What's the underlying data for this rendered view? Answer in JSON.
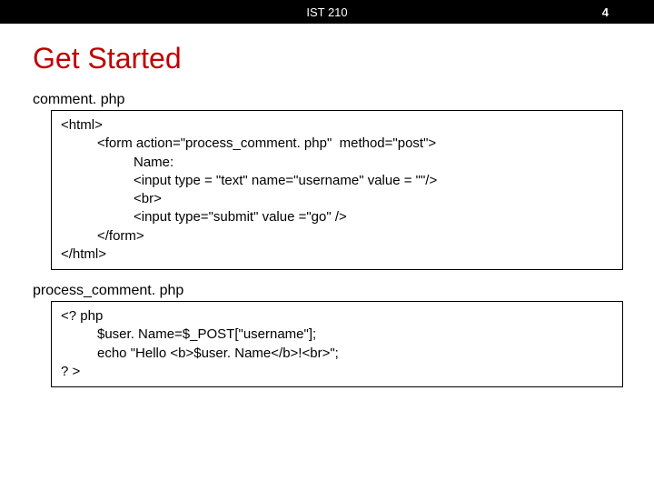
{
  "header": {
    "course": "IST 210",
    "page_number": "4"
  },
  "title": "Get Started",
  "file1": {
    "name": "comment. php",
    "code": {
      "l1": "<html>",
      "l2": "<form action=\"process_comment. php\"  method=\"post\">",
      "l3": "Name:",
      "l4": "<input type = \"text\" name=\"username\" value = \"\"/>",
      "l5": "<br>",
      "l6": "<input type=\"submit\" value =\"go\" />",
      "l7": "</form>",
      "l8": "</html>"
    }
  },
  "file2": {
    "name": "process_comment. php",
    "code": {
      "l1": "<? php",
      "l2": "$user. Name=$_POST[\"username\"];",
      "l3": "echo \"Hello <b>$user. Name</b>!<br>\";",
      "l4": "? >"
    }
  }
}
